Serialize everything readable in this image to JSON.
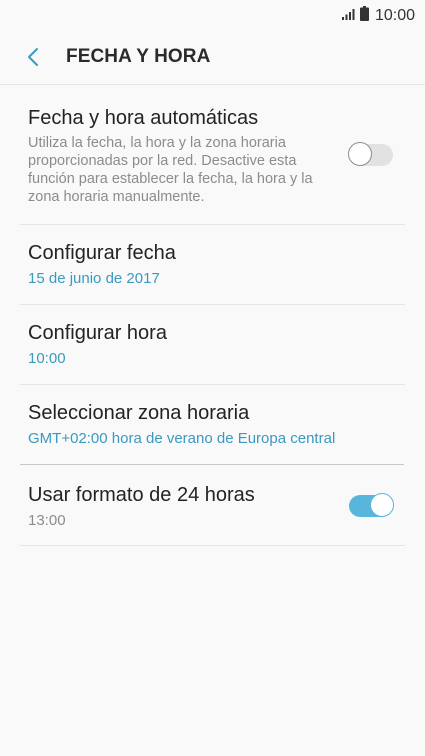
{
  "status_bar": {
    "time": "10:00",
    "signal_icon": "signal-icon",
    "battery_icon": "battery-icon"
  },
  "header": {
    "back_icon": "back-arrow-icon",
    "title": "FECHA Y HORA"
  },
  "settings": {
    "auto_datetime": {
      "title": "Fecha y hora automáticas",
      "description": "Utiliza la fecha, la hora y la zona horaria proporcionadas por la red. Desactive esta función para establecer la fecha, la hora y la zona horaria manualmente.",
      "enabled": false
    },
    "set_date": {
      "title": "Configurar fecha",
      "value": "15 de junio de 2017"
    },
    "set_time": {
      "title": "Configurar hora",
      "value": "10:00"
    },
    "time_zone": {
      "title": "Seleccionar zona horaria",
      "value": "GMT+02:00 hora de verano de Europa central"
    },
    "format_24h": {
      "title": "Usar formato de 24 horas",
      "value": "13:00",
      "enabled": true
    }
  },
  "colors": {
    "accent": "#3a9ac0",
    "toggle_on": "#58b6dd",
    "background": "#f9f9f9"
  }
}
